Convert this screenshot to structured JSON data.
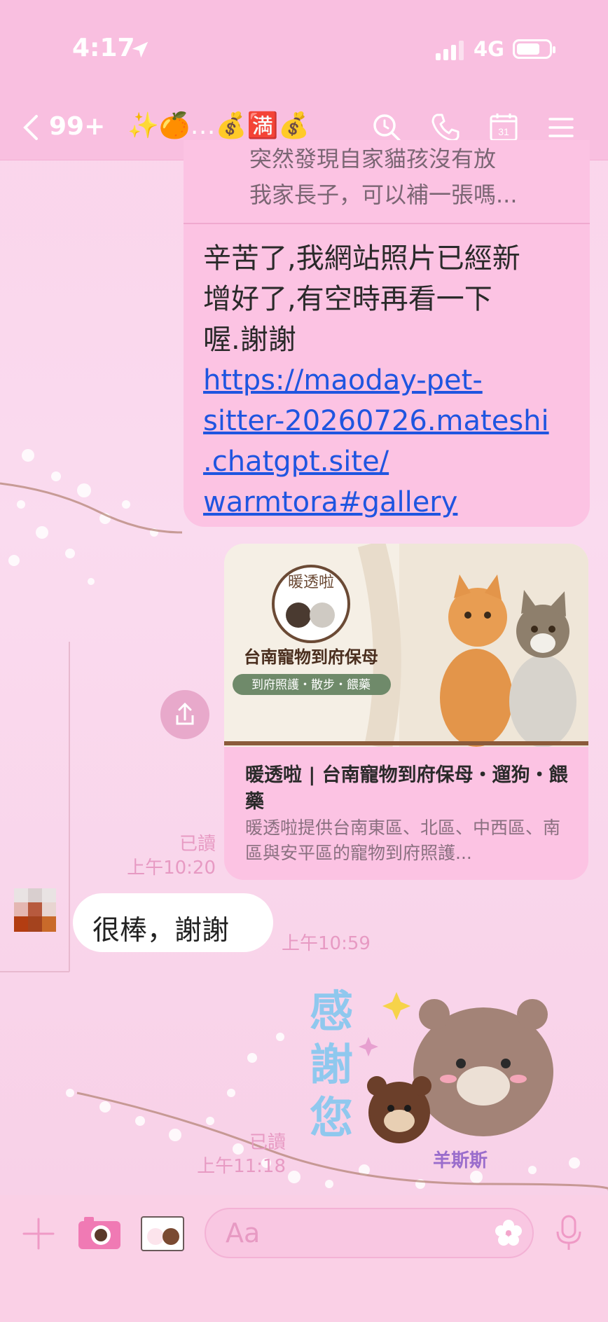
{
  "status_bar": {
    "time": "4:17",
    "network": "4G"
  },
  "header": {
    "back_label": "99+",
    "chat_title": "✨🍊…💰🈵💰",
    "icons": [
      "chevron-left-icon",
      "search-icon",
      "phone-icon",
      "calendar-icon",
      "menu-icon"
    ],
    "calendar_day": "31"
  },
  "messages": {
    "quote": {
      "line1": "突然發現自家貓孩沒有放",
      "line2": "我家長子，可以補一張嗎..."
    },
    "reply": {
      "text_line1": "辛苦了,我網站照片已經新",
      "text_line2": "增好了,有空時再看一下",
      "text_line3": "喔.謝謝",
      "link_line1": "https://maoday-pet-",
      "link_line2": "sitter-20260726.mateshi",
      "link_line3": ".chatgpt.site/",
      "link_line4": "warmtora#gallery"
    },
    "card": {
      "logo_text": "暖透啦",
      "banner_title": "台南寵物到府保母",
      "banner_sub": "到府照護・散步・餵藥",
      "title": "暖透啦 | 台南寵物到府保母・遛狗・餵藥",
      "desc": "暖透啦提供台南東區、北區、中西區、南區與安平區的寵物到府照護..."
    },
    "card_read": "已讀",
    "card_time": "上午10:20",
    "incoming": {
      "text": "很棒，謝謝",
      "time": "上午10:59"
    },
    "sticker": {
      "text_vertical": "感謝您",
      "credit": "羊斯斯"
    },
    "sticker_read": "已讀",
    "sticker_time": "上午11:18"
  },
  "input_bar": {
    "placeholder": "Aa"
  },
  "colors": {
    "header": "#f9bfe0",
    "bubble": "#fcc3e3",
    "meta": "#e79ac3",
    "link": "#1f55e0"
  }
}
